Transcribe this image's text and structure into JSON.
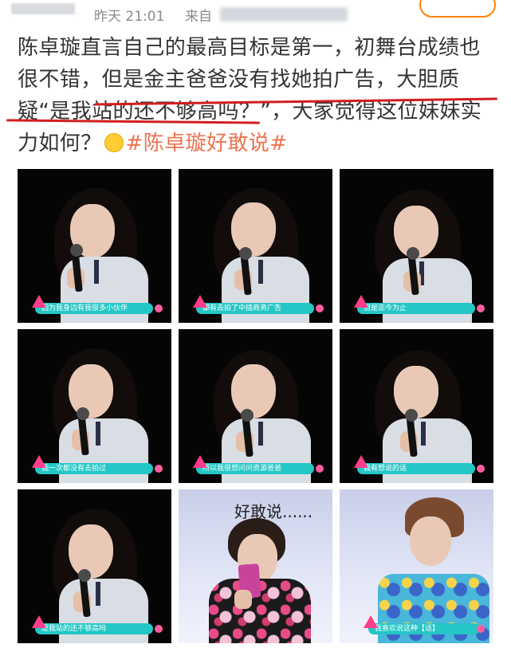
{
  "header": {
    "time": "昨天 21:01",
    "via": "来自"
  },
  "post": {
    "line1": "陈卓璇直言自己的最高目标是第一，初舞台成绩也",
    "line2_a": "很不错，",
    "line2_b": "但是金主爸爸没有找她拍广告，大胆质",
    "line3_a": "疑“是我站的还不够高吗？”",
    "line3_b": "，大家觉得这位妹妹实",
    "line4_a": "力如何？",
    "line4_tag": "#陈卓璇好敢说#",
    "emoji_icon": "thinking-emoji-icon"
  },
  "subtitles": {
    "p1": "因为我身边有我很多小伙伴",
    "p2": "都有去拍了中插商务广告",
    "p3": "但是迄今为止",
    "p4": "我一次都没有去拍过",
    "p5": "所以我很想问问资源爸爸",
    "p6": "我有想说的话",
    "p7": "是我站的还不够高吗",
    "p9": "我喜欢说这种【话】"
  },
  "panel8_caption": "好敢说......",
  "accent_colors": {
    "tag": "#eb7350",
    "underline": "#d21e1e",
    "subtitle_bar": "#25c6c6",
    "show_logo": "#ff3d8a",
    "follow_border": "#ff8200"
  }
}
